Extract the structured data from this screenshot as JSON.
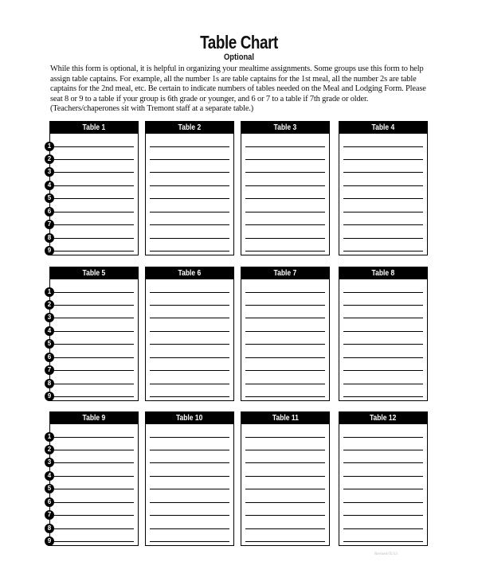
{
  "header": {
    "title": "Table Chart",
    "subtitle": "Optional",
    "intro": "While this form is optional, it is helpful in organizing your mealtime assignments. Some groups use this form to help assign table captains. For example, all the number 1s are table captains for the 1st meal, all the number 2s are table captains for the 2nd meal, etc. Be certain to indicate numbers of tables needed on the Meal and Lodging Form. Please seat 8 or 9 to a table if your group is 6th grade or younger, and 6 or 7 to a table if 7th grade or older. (Teachers/chaperones sit with Tremont staff at a separate table.)"
  },
  "seat_numbers": [
    "1",
    "2",
    "3",
    "4",
    "5",
    "6",
    "7",
    "8",
    "9"
  ],
  "tables": [
    {
      "label": "Table 1"
    },
    {
      "label": "Table 2"
    },
    {
      "label": "Table 3"
    },
    {
      "label": "Table 4"
    },
    {
      "label": "Table 5"
    },
    {
      "label": "Table 6"
    },
    {
      "label": "Table 7"
    },
    {
      "label": "Table 8"
    },
    {
      "label": "Table 9"
    },
    {
      "label": "Table 10"
    },
    {
      "label": "Table 11"
    },
    {
      "label": "Table 12"
    }
  ],
  "footer": {
    "text": "Revised 05/13"
  }
}
